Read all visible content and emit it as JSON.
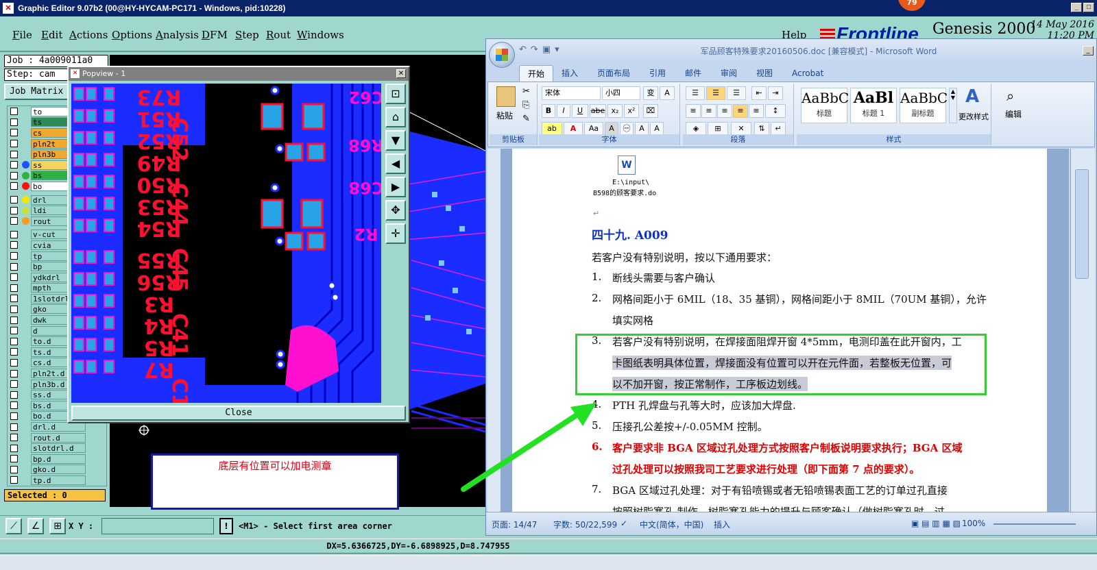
{
  "genesis": {
    "title": "Graphic Editor 9.07b2 (00@HY-HYCAM-PC171 - Windows, pid:10228)",
    "menu": [
      "File",
      "Edit",
      "Actions",
      "Options",
      "Analysis",
      "DFM",
      "Step",
      "Rout",
      "Windows"
    ],
    "help": "Help",
    "logo_text": "Frontline",
    "product": "Genesis 2000",
    "date": "14 May 2016",
    "time": "11:20 PM",
    "notification_count": "79",
    "job_label": "Job : 4a009011a0",
    "step_label": "Step: cam",
    "job_matrix_label": "Job Matrix",
    "selected_label": "Selected : 0",
    "xy_label": "X Y :",
    "xy_value": "",
    "prompt": "<M1> - Select first area corner",
    "status": "DX=5.6366725,DY=-6.6898925,D=8.747955",
    "note": "底层有位置可以加电测章"
  },
  "layers": [
    {
      "name": "to",
      "color": "#ffffff",
      "dot": ""
    },
    {
      "name": "ts",
      "color": "#2e8b57",
      "dot": ""
    },
    {
      "name": "cs",
      "color": "#f0a830",
      "dot": ""
    },
    {
      "name": "pln2t",
      "color": "#f0a830",
      "dot": ""
    },
    {
      "name": "pln3b",
      "color": "#f0a830",
      "dot": ""
    },
    {
      "name": "ss",
      "color": "#f5d35c",
      "dot": "#1e50ff"
    },
    {
      "name": "bs",
      "color": "#30b040",
      "dot": "#30b040"
    },
    {
      "name": "bo",
      "color": "#ffffff",
      "dot": "#ff1010"
    },
    {
      "name": "drl",
      "color": "#9fd7cf",
      "dot": "#f5e600"
    },
    {
      "name": "ldi",
      "color": "#9fd7cf",
      "dot": "#c8e040"
    },
    {
      "name": "rout",
      "color": "#9fd7cf",
      "dot": "#ff9a20"
    },
    {
      "name": "v-cut",
      "color": "#9fd7cf",
      "dot": ""
    },
    {
      "name": "cvia",
      "color": "#9fd7cf",
      "dot": ""
    },
    {
      "name": "tp",
      "color": "#9fd7cf",
      "dot": ""
    },
    {
      "name": "bp",
      "color": "#9fd7cf",
      "dot": ""
    },
    {
      "name": "ydkdrl",
      "color": "#9fd7cf",
      "dot": ""
    },
    {
      "name": "mpth",
      "color": "#9fd7cf",
      "dot": ""
    },
    {
      "name": "1slotdrl",
      "color": "#9fd7cf",
      "dot": ""
    },
    {
      "name": "gko",
      "color": "#9fd7cf",
      "dot": ""
    },
    {
      "name": "dwk",
      "color": "#9fd7cf",
      "dot": ""
    },
    {
      "name": "d",
      "color": "#9fd7cf",
      "dot": ""
    },
    {
      "name": "to.d",
      "color": "#9fd7cf",
      "dot": ""
    },
    {
      "name": "ts.d",
      "color": "#9fd7cf",
      "dot": ""
    },
    {
      "name": "cs.d",
      "color": "#9fd7cf",
      "dot": ""
    },
    {
      "name": "pln2t.d",
      "color": "#9fd7cf",
      "dot": ""
    },
    {
      "name": "pln3b.d",
      "color": "#9fd7cf",
      "dot": ""
    },
    {
      "name": "ss.d",
      "color": "#9fd7cf",
      "dot": ""
    },
    {
      "name": "bs.d",
      "color": "#9fd7cf",
      "dot": ""
    },
    {
      "name": "bo.d",
      "color": "#9fd7cf",
      "dot": ""
    },
    {
      "name": "drl.d",
      "color": "#9fd7cf",
      "dot": ""
    },
    {
      "name": "rout.d",
      "color": "#9fd7cf",
      "dot": ""
    },
    {
      "name": "slotdrl.d",
      "color": "#9fd7cf",
      "dot": ""
    },
    {
      "name": "bp.d",
      "color": "#9fd7cf",
      "dot": ""
    },
    {
      "name": "gko.d",
      "color": "#9fd7cf",
      "dot": ""
    },
    {
      "name": "tp.d",
      "color": "#9fd7cf",
      "dot": ""
    }
  ],
  "popview": {
    "title": "Popview - 1",
    "close_label": "Close",
    "refs_left": [
      "R73",
      "R51",
      "R52",
      "R49",
      "R50",
      "R53",
      "R54",
      "R55",
      "R56",
      "R3",
      "R4",
      "R5",
      "R7"
    ],
    "refs_mid": [
      "C52",
      "C44",
      "C45",
      "C41",
      "C13"
    ],
    "refs_right": [
      "C62",
      "R68",
      "C68",
      "R2"
    ]
  },
  "word": {
    "title": "军品顾客特殊要求20160506.doc [兼容模式] - Microsoft Word",
    "tabs": [
      "开始",
      "插入",
      "页面布局",
      "引用",
      "邮件",
      "审阅",
      "视图",
      "Acrobat"
    ],
    "groups": {
      "clipboard": "剪贴板",
      "font": "字体",
      "paragraph": "段落",
      "styles": "样式",
      "edit": "编辑"
    },
    "paste": "粘贴",
    "font_name": "宋体",
    "font_size": "小四",
    "styles": [
      {
        "preview": "AaBbC",
        "name": "标题"
      },
      {
        "preview": "AaBl",
        "name": "标题 1"
      },
      {
        "preview": "AaBbC",
        "name": "副标题"
      }
    ],
    "change_styles": "更改样式",
    "edit_label": "编辑",
    "attachment_path": "E:\\input\\",
    "attachment_name": "B598的顾客要求.do",
    "heading": "四十九. A009",
    "intro": "若客户没有特别说明，按以下通用要求：",
    "items": [
      {
        "num": "1.",
        "lines": [
          "断线头需要与客户确认"
        ]
      },
      {
        "num": "2.",
        "lines": [
          "网格间距小于 6MIL（18、35 基铜），网格间距小于 8MIL（70UM 基铜），允许",
          "填实网格"
        ]
      },
      {
        "num": "3.",
        "lines": [
          "若客户没有特别说明，在焊接面阻焊开窗 4*5mm，电测印盖在此开窗内，工",
          "卡图纸表明具体位置，焊接面没有位置可以开在元件面，若整板无位置，可",
          "以不加开窗，按正常制作，工序板边划线。"
        ]
      },
      {
        "num": "4.",
        "lines": [
          "PTH 孔焊盘与孔等大时，应该加大焊盘."
        ]
      },
      {
        "num": "5.",
        "lines": [
          "压接孔公差按+/-0.05MM 控制。"
        ]
      },
      {
        "num": "6.",
        "lines": [
          "客户要求非 BGA 区域过孔处理方式按照客户制板说明要求执行；BGA 区域",
          "过孔处理可以按照我司工艺要求进行处理（即下面第 7 点的要求）。"
        ]
      },
      {
        "num": "7.",
        "lines": [
          "BGA 区域过孔处理：对于有铅喷锡或者无铅喷锡表面工艺的订单过孔直接",
          "按照树脂塞孔 制作，树脂塞孔能力的提升与顾客确认（做树脂塞孔时，过"
        ]
      }
    ],
    "status": {
      "page": "页面: 14/47",
      "words": "字数: 50/22,599",
      "lang": "中文(简体，中国)",
      "mode": "插入",
      "zoom": "100%"
    }
  }
}
